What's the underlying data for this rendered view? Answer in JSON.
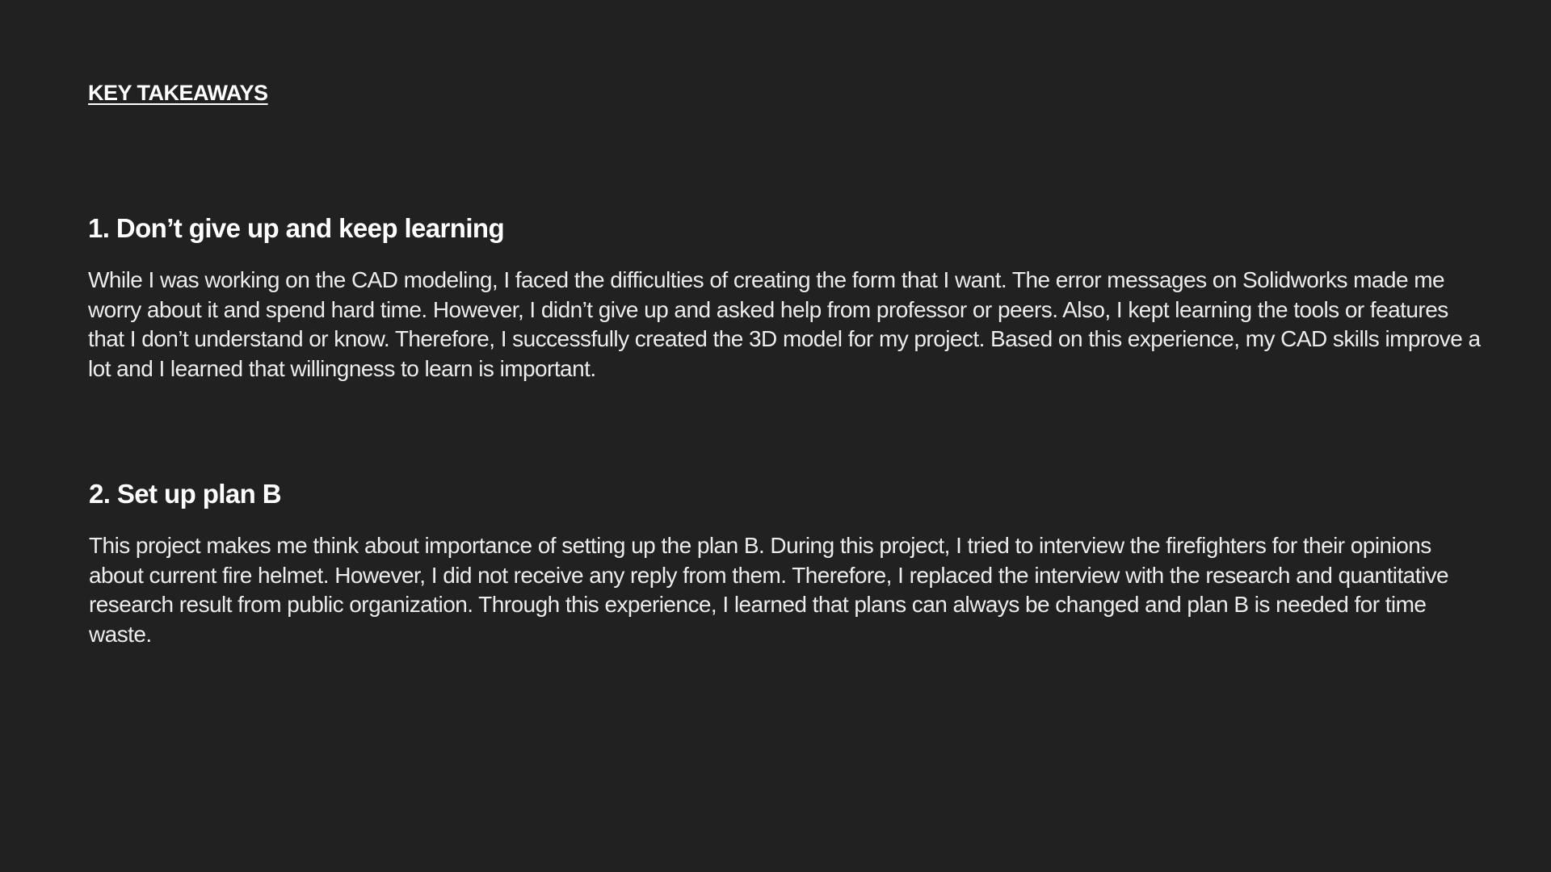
{
  "header": {
    "title": "KEY TAKEAWAYS"
  },
  "sections": [
    {
      "title": "1. Don’t give up and keep learning",
      "body": "While I was working on the CAD modeling, I faced the difficulties of creating the form that I want. The error messages on Solidworks made me worry about it and spend hard time. However, I didn’t give up and asked help from professor or peers. Also, I kept learning the tools or features that I don’t understand or know. Therefore, I successfully created the 3D model for my project. Based on this experience, my CAD skills improve a lot and I learned that willingness to learn is important."
    },
    {
      "title": "2. Set up plan B",
      "body": "This project makes me think about importance of setting up the plan B. During this project, I tried to interview the firefighters for their opinions about current fire helmet. However, I did not receive any reply from them. Therefore, I replaced the interview with the research and quantitative research result from public organization. Through this experience, I learned that plans can always  be changed and plan B is needed for time waste."
    }
  ],
  "colors": {
    "background": "#212121",
    "text": "#f2f2f2"
  }
}
